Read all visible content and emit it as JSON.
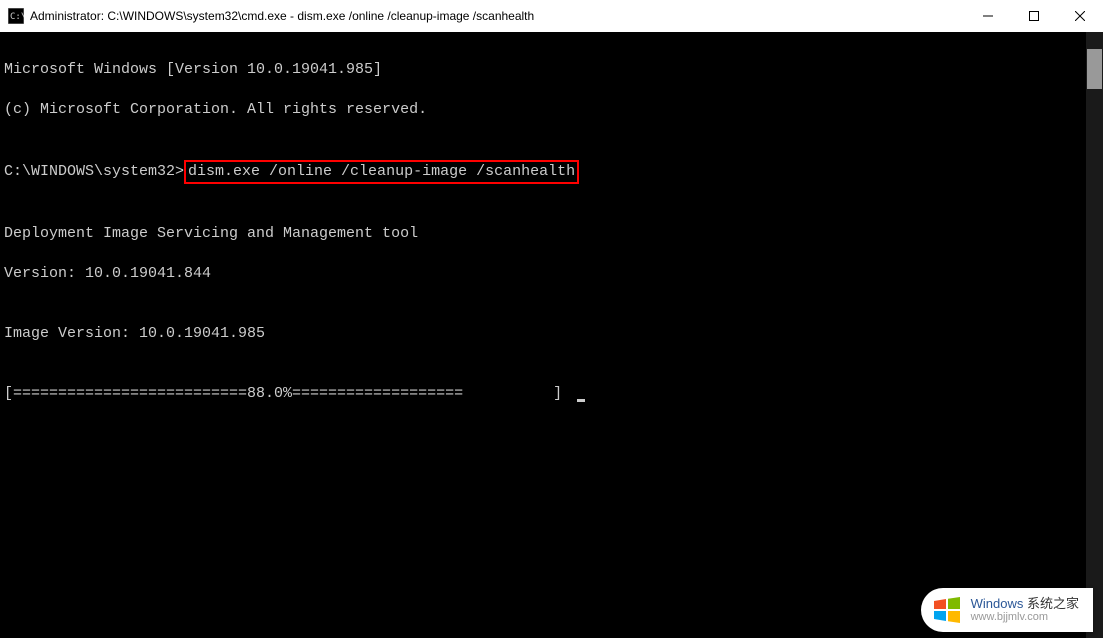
{
  "titlebar": {
    "title": "Administrator: C:\\WINDOWS\\system32\\cmd.exe - dism.exe  /online /cleanup-image /scanhealth"
  },
  "terminal": {
    "line1": "Microsoft Windows [Version 10.0.19041.985]",
    "line2": "(c) Microsoft Corporation. All rights reserved.",
    "blank1": "",
    "prompt": "C:\\WINDOWS\\system32>",
    "command": "dism.exe /online /cleanup-image /scanhealth",
    "blank2": "",
    "line3": "Deployment Image Servicing and Management tool",
    "line4": "Version: 10.0.19041.844",
    "blank3": "",
    "line5": "Image Version: 10.0.19041.985",
    "blank4": "",
    "progress": "[==========================88.0%===================          ] "
  },
  "watermark": {
    "brand": "Windows",
    "suffix": "系统之家",
    "url": "www.bjjmlv.com"
  }
}
